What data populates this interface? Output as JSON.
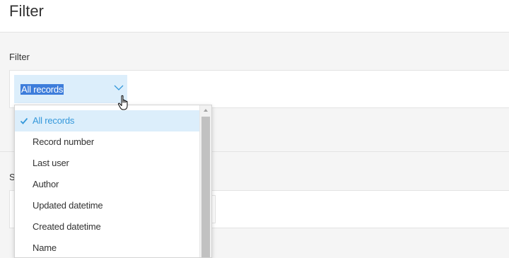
{
  "header": {
    "title": "Filter"
  },
  "filter_section": {
    "label": "Filter"
  },
  "select": {
    "value": "All records"
  },
  "dropdown": {
    "options": [
      {
        "label": "All records",
        "selected": true
      },
      {
        "label": "Record number"
      },
      {
        "label": "Last user"
      },
      {
        "label": "Author"
      },
      {
        "label": "Updated datetime"
      },
      {
        "label": "Created datetime"
      },
      {
        "label": "Name"
      }
    ]
  },
  "sort_section": {
    "label": "S"
  },
  "colors": {
    "accent": "#3498db",
    "selection_bg": "#dceefb",
    "highlight": "#3d7ddb"
  }
}
